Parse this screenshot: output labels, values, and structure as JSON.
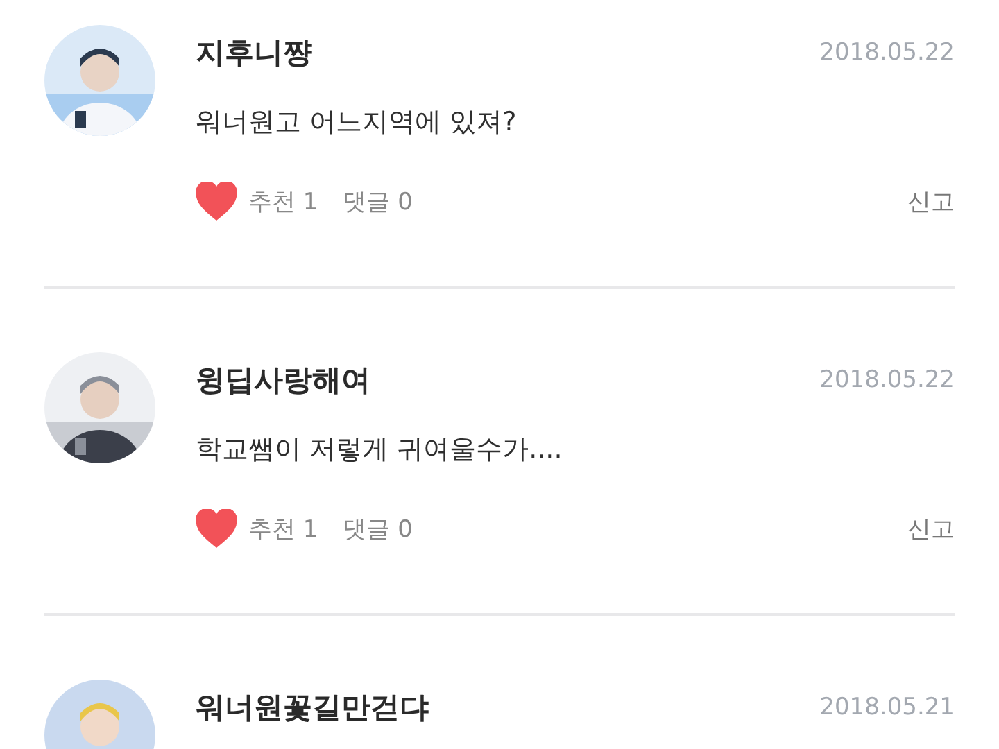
{
  "comments": [
    {
      "author": "지후니쨩",
      "date": "2018.05.22",
      "message": "워너원고 어느지역에 있져?",
      "liked": true,
      "likes": "추천 1",
      "replies": "댓글 0",
      "report": "신고"
    },
    {
      "author": "윙딥사랑해여",
      "date": "2018.05.22",
      "message": "학교쌤이 저렇게 귀여울수가....",
      "liked": true,
      "likes": "추천 1",
      "replies": "댓글 0",
      "report": "신고"
    },
    {
      "author": "워너원꽃길만걷댜",
      "date": "2018.05.21"
    }
  ]
}
